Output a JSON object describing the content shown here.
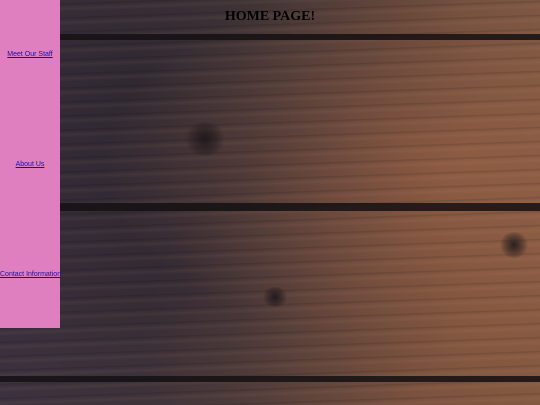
{
  "page": {
    "title": "HOME PAGE!"
  },
  "sidebar": {
    "background_color": "#e07fbf",
    "items": [
      {
        "label": "Meet Our Staff"
      },
      {
        "label": "About Us"
      },
      {
        "label": "Contact Information"
      }
    ]
  },
  "colors": {
    "link": "#1a0dab",
    "title": "#000000"
  }
}
